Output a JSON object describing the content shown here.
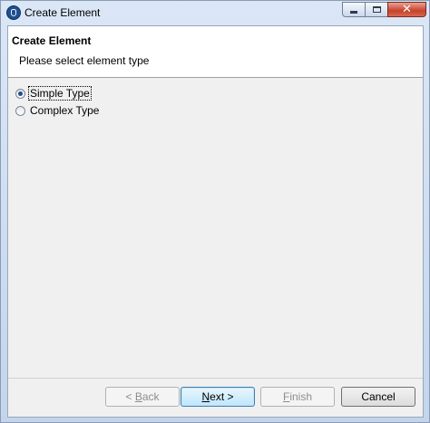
{
  "window": {
    "title": "Create Element",
    "icon": "app-icon",
    "controls": {
      "minimize": "minimize-icon",
      "maximize": "maximize-icon",
      "close": "close-icon"
    }
  },
  "header": {
    "title": "Create Element",
    "description": "Please select element type"
  },
  "options": [
    {
      "label": "Simple Type",
      "checked": true
    },
    {
      "label": "Complex Type",
      "checked": false
    }
  ],
  "buttons": {
    "back": {
      "prefix": "< ",
      "mnemonic": "B",
      "rest": "ack",
      "enabled": false
    },
    "next": {
      "mnemonic": "N",
      "rest": "ext >",
      "enabled": true
    },
    "finish": {
      "mnemonic": "F",
      "rest": "inish",
      "enabled": false
    },
    "cancel": {
      "label": "Cancel",
      "enabled": true
    }
  },
  "colors": {
    "accent": "#3c7fb1",
    "close": "#c7412b"
  }
}
